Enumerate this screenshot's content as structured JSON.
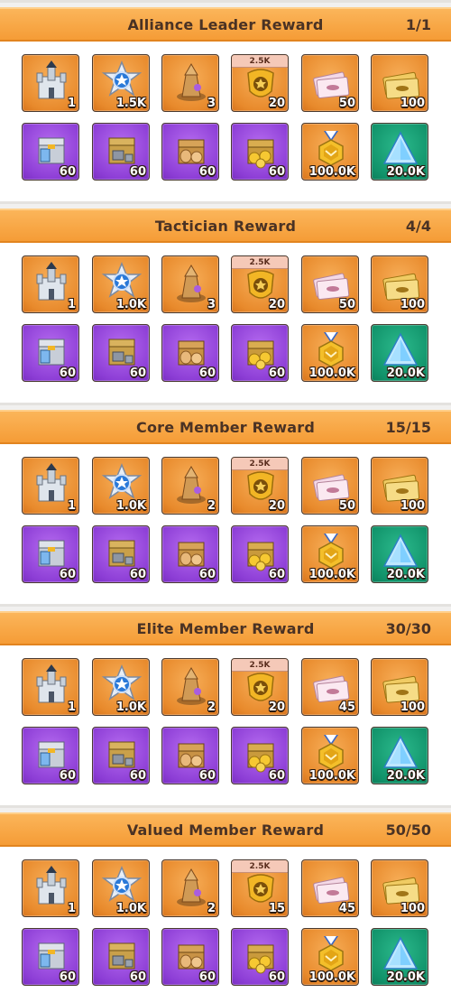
{
  "sections": [
    {
      "title": "Alliance Leader Reward",
      "count": "1/1",
      "items": [
        {
          "icon": "castle-icon",
          "value": "1"
        },
        {
          "icon": "star-emblem-icon",
          "value": "1.5K"
        },
        {
          "icon": "tower-icon",
          "value": "3"
        },
        {
          "icon": "badge-icon",
          "value": "20",
          "tag": "2.5K"
        },
        {
          "icon": "ticket-icon",
          "value": "50"
        },
        {
          "icon": "gold-ticket-icon",
          "value": "100"
        },
        {
          "icon": "iron-chest-icon",
          "value": "60"
        },
        {
          "icon": "steel-chest-icon",
          "value": "60"
        },
        {
          "icon": "food-chest-icon",
          "value": "60"
        },
        {
          "icon": "coin-chest-icon",
          "value": "60"
        },
        {
          "icon": "medal-icon",
          "value": "100.0K"
        },
        {
          "icon": "crystal-icon",
          "value": "20.0K"
        }
      ]
    },
    {
      "title": "Tactician Reward",
      "count": "4/4",
      "items": [
        {
          "icon": "castle-icon",
          "value": "1"
        },
        {
          "icon": "star-emblem-icon",
          "value": "1.0K"
        },
        {
          "icon": "tower-icon",
          "value": "3"
        },
        {
          "icon": "badge-icon",
          "value": "20",
          "tag": "2.5K"
        },
        {
          "icon": "ticket-icon",
          "value": "50"
        },
        {
          "icon": "gold-ticket-icon",
          "value": "100"
        },
        {
          "icon": "iron-chest-icon",
          "value": "60"
        },
        {
          "icon": "steel-chest-icon",
          "value": "60"
        },
        {
          "icon": "food-chest-icon",
          "value": "60"
        },
        {
          "icon": "coin-chest-icon",
          "value": "60"
        },
        {
          "icon": "medal-icon",
          "value": "100.0K"
        },
        {
          "icon": "crystal-icon",
          "value": "20.0K"
        }
      ]
    },
    {
      "title": "Core Member Reward",
      "count": "15/15",
      "items": [
        {
          "icon": "castle-icon",
          "value": "1"
        },
        {
          "icon": "star-emblem-icon",
          "value": "1.0K"
        },
        {
          "icon": "tower-icon",
          "value": "2"
        },
        {
          "icon": "badge-icon",
          "value": "20",
          "tag": "2.5K"
        },
        {
          "icon": "ticket-icon",
          "value": "50"
        },
        {
          "icon": "gold-ticket-icon",
          "value": "100"
        },
        {
          "icon": "iron-chest-icon",
          "value": "60"
        },
        {
          "icon": "steel-chest-icon",
          "value": "60"
        },
        {
          "icon": "food-chest-icon",
          "value": "60"
        },
        {
          "icon": "coin-chest-icon",
          "value": "60"
        },
        {
          "icon": "medal-icon",
          "value": "100.0K"
        },
        {
          "icon": "crystal-icon",
          "value": "20.0K"
        }
      ]
    },
    {
      "title": "Elite Member Reward",
      "count": "30/30",
      "items": [
        {
          "icon": "castle-icon",
          "value": "1"
        },
        {
          "icon": "star-emblem-icon",
          "value": "1.0K"
        },
        {
          "icon": "tower-icon",
          "value": "2"
        },
        {
          "icon": "badge-icon",
          "value": "20",
          "tag": "2.5K"
        },
        {
          "icon": "ticket-icon",
          "value": "45"
        },
        {
          "icon": "gold-ticket-icon",
          "value": "100"
        },
        {
          "icon": "iron-chest-icon",
          "value": "60"
        },
        {
          "icon": "steel-chest-icon",
          "value": "60"
        },
        {
          "icon": "food-chest-icon",
          "value": "60"
        },
        {
          "icon": "coin-chest-icon",
          "value": "60"
        },
        {
          "icon": "medal-icon",
          "value": "100.0K"
        },
        {
          "icon": "crystal-icon",
          "value": "20.0K"
        }
      ]
    },
    {
      "title": "Valued Member Reward",
      "count": "50/50",
      "items": [
        {
          "icon": "castle-icon",
          "value": "1"
        },
        {
          "icon": "star-emblem-icon",
          "value": "1.0K"
        },
        {
          "icon": "tower-icon",
          "value": "2"
        },
        {
          "icon": "badge-icon",
          "value": "15",
          "tag": "2.5K"
        },
        {
          "icon": "ticket-icon",
          "value": "45"
        },
        {
          "icon": "gold-ticket-icon",
          "value": "100"
        },
        {
          "icon": "iron-chest-icon",
          "value": "60"
        },
        {
          "icon": "steel-chest-icon",
          "value": "60"
        },
        {
          "icon": "food-chest-icon",
          "value": "60"
        },
        {
          "icon": "coin-chest-icon",
          "value": "60"
        },
        {
          "icon": "medal-icon",
          "value": "100.0K"
        },
        {
          "icon": "crystal-icon",
          "value": "20.0K"
        }
      ]
    }
  ],
  "colors": {
    "orange": "#e88a2c",
    "purple": "#8d3ed6",
    "green": "#11936a",
    "header": "#f7a444"
  }
}
